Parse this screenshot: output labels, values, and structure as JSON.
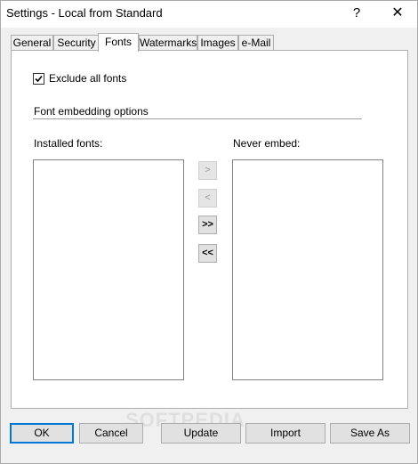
{
  "window": {
    "title": "Settings - Local from Standard",
    "help_glyph": "?",
    "close_glyph": "✕"
  },
  "tabs": [
    {
      "label": "General"
    },
    {
      "label": "Security"
    },
    {
      "label": "Fonts",
      "active": true
    },
    {
      "label": "Watermarks"
    },
    {
      "label": "Images"
    },
    {
      "label": "e-Mail"
    }
  ],
  "fonts_tab": {
    "exclude_all_label": "Exclude all fonts",
    "exclude_all_checked": true,
    "group_title": "Font embedding options",
    "installed_label": "Installed fonts:",
    "never_embed_label": "Never embed:",
    "move_one_right": ">",
    "move_one_left": "<",
    "move_all_right": ">>",
    "move_all_left": "<<"
  },
  "footer": {
    "ok": "OK",
    "cancel": "Cancel",
    "update": "Update",
    "import": "Import",
    "save_as": "Save As"
  },
  "watermark": "SOFTPEDIA"
}
